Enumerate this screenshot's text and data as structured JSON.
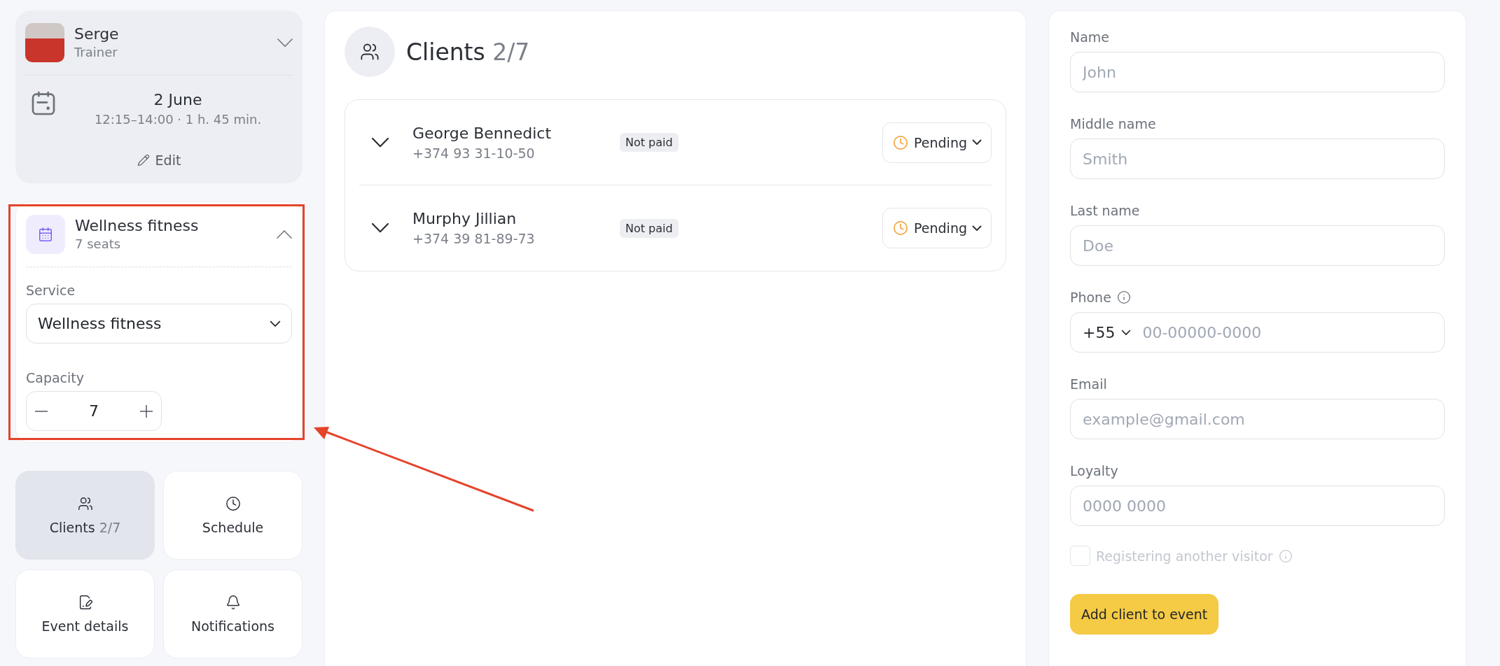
{
  "trainer": {
    "name": "Serge",
    "role": "Trainer",
    "expanded": false
  },
  "event": {
    "date": "2 June",
    "time": "12:15–14:00 · 1 h. 45 min.",
    "edit": "Edit"
  },
  "service_card": {
    "title": "Wellness fitness",
    "subtitle": "7 seats",
    "expanded": true,
    "service_label": "Service",
    "service_value": "Wellness fitness",
    "capacity_label": "Capacity",
    "capacity_value": "7"
  },
  "nav": [
    {
      "kind": "clients",
      "label": "Clients",
      "count": "2/7",
      "selected": true
    },
    {
      "kind": "schedule",
      "label": "Schedule",
      "selected": false
    },
    {
      "kind": "details",
      "label": "Event details",
      "selected": false
    },
    {
      "kind": "notifications",
      "label": "Notifications",
      "selected": false
    }
  ],
  "clients_panel": {
    "title": "Clients",
    "count": "2/7",
    "clients": [
      {
        "name": "George Bennedict",
        "phone": "+374 93 31-10-50",
        "payment": "Not paid",
        "status": "Pending",
        "expanded": false
      },
      {
        "name": "Murphy Jillian",
        "phone": "+374 39 81-89-73",
        "payment": "Not paid",
        "status": "Pending",
        "expanded": false
      }
    ]
  },
  "form": {
    "fields": [
      {
        "kind": "text",
        "label": "Name",
        "placeholder": "John"
      },
      {
        "kind": "text",
        "label": "Middle name",
        "placeholder": "Smith"
      },
      {
        "kind": "text",
        "label": "Last name",
        "placeholder": "Doe"
      },
      {
        "kind": "phone",
        "label": "Phone",
        "info": true,
        "code": "+55",
        "placeholder": "00-00000-0000"
      },
      {
        "kind": "text",
        "label": "Email",
        "placeholder": "example@gmail.com"
      },
      {
        "kind": "text",
        "label": "Loyalty",
        "placeholder": "0000 0000"
      }
    ],
    "checkbox": {
      "label": "Registering another visitor",
      "checked": false,
      "disabled": true,
      "info": true
    },
    "submit": "Add client to event"
  }
}
